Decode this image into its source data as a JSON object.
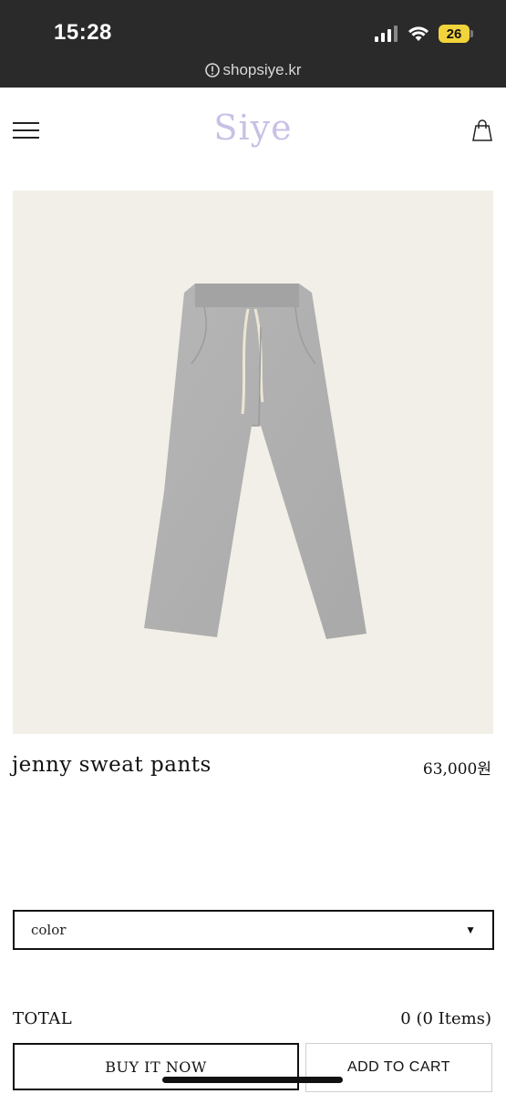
{
  "status_bar": {
    "time": "15:28",
    "battery": "26",
    "url": "shopsiye.kr"
  },
  "header": {
    "logo": "Siye",
    "logo_color": "#c9c0e6"
  },
  "product": {
    "name": "jenny sweat pants",
    "price": "63,000원",
    "image_icon": "sweat-pants-photo",
    "image_background": "#f1efe7"
  },
  "options": {
    "color_label": "color",
    "caret": "▼"
  },
  "total": {
    "label": "TOTAL",
    "value": "0 (0 Items)"
  },
  "actions": {
    "buy_label": "BUY IT NOW",
    "cart_label": "ADD TO CART"
  }
}
